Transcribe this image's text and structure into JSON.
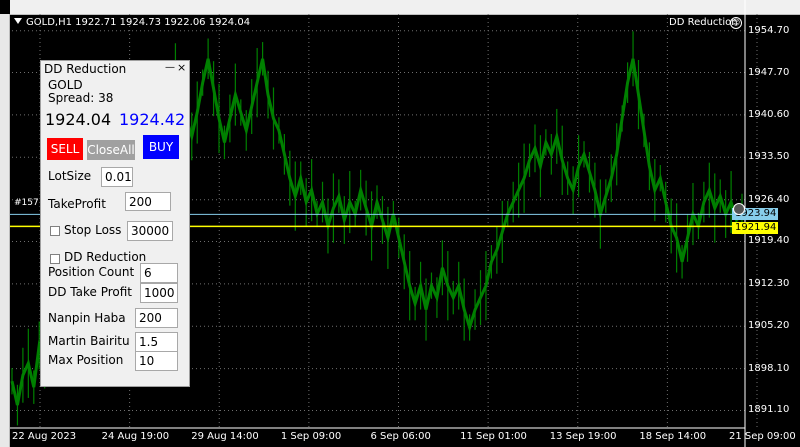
{
  "header": {
    "symbol_info": "GOLD,H1  1922.71 1924.73 1922.06 1924.04",
    "ea_name": "DD Reduction",
    "ea_icon": "smiley-icon"
  },
  "price_axis": [
    "1954.70",
    "1947.70",
    "1940.60",
    "1933.50",
    "1926.40",
    "1919.40",
    "1912.30",
    "1905.20",
    "1898.10",
    "1891.10"
  ],
  "time_axis": [
    "22 Aug 2023",
    "24 Aug 19:00",
    "29 Aug 14:00",
    "1 Sep 09:00",
    "6 Sep 06:00",
    "11 Sep 01:00",
    "13 Sep 19:00",
    "18 Sep 14:00",
    "21 Sep 09:00"
  ],
  "lines": {
    "ask_label": "1923.94",
    "bid_label": "1921.94",
    "order_tag": "#157",
    "ask_color": "#87ceeb",
    "bid_color": "#ffff00"
  },
  "panel": {
    "title": "DD Reduction",
    "min_label": "—",
    "close_label": "×",
    "symbol": "GOLD",
    "spread": "Spread: 38",
    "bid": "1924.04",
    "ask": "1924.42",
    "sell_label": "SELL",
    "closeall_label": "CloseAll",
    "buy_label": "BUY",
    "lotsize_label": "LotSize",
    "lotsize_value": "0.01",
    "takeprofit_label": "TakeProfit",
    "takeprofit_value": "200",
    "stoploss_label": "Stop Loss",
    "stoploss_value": "30000",
    "ddreduction_label": "DD Reduction",
    "position_count_label": "Position Count",
    "position_count_value": "6",
    "dd_takeprofit_label": "DD Take Profit",
    "dd_takeprofit_value": "1000",
    "nanpin_label": "Nanpin Haba",
    "nanpin_value": "200",
    "martin_label": "Martin Bairitu",
    "martin_value": "1.5",
    "maxpos_label": "Max Position",
    "maxpos_value": "10",
    "sell_color": "#ff0000",
    "buy_color": "#0000ff",
    "closeall_color": "#a0a0a0"
  },
  "chart_data": {
    "type": "line",
    "title": "",
    "xlabel": "",
    "ylabel": "",
    "ylim": [
      1888.5,
      1957.5
    ],
    "color": "#008000",
    "y": [
      1896,
      1892,
      1897,
      1899,
      1895,
      1902,
      1900,
      1905,
      1910,
      1912,
      1908,
      1914,
      1918,
      1922,
      1920,
      1926,
      1930,
      1928,
      1934,
      1938,
      1936,
      1942,
      1940,
      1938,
      1944,
      1946,
      1943,
      1939,
      1941,
      1945,
      1948,
      1944,
      1940,
      1937,
      1941,
      1946,
      1950,
      1945,
      1940,
      1936,
      1940,
      1944,
      1941,
      1938,
      1942,
      1946,
      1950,
      1944,
      1940,
      1938,
      1934,
      1930,
      1927,
      1930,
      1926,
      1928,
      1924,
      1926,
      1922,
      1925,
      1927,
      1923,
      1926,
      1924,
      1928,
      1925,
      1922,
      1926,
      1923,
      1920,
      1924,
      1920,
      1916,
      1912,
      1909,
      1912,
      1908,
      1912,
      1910,
      1915,
      1912,
      1910,
      1912,
      1908,
      1905,
      1908,
      1910,
      1912,
      1916,
      1918,
      1921,
      1924,
      1926,
      1928,
      1930,
      1933,
      1935,
      1932,
      1936,
      1934,
      1937,
      1933,
      1930,
      1928,
      1932,
      1934,
      1931,
      1928,
      1924,
      1927,
      1930,
      1934,
      1940,
      1946,
      1950,
      1944,
      1938,
      1932,
      1928,
      1930,
      1926,
      1922,
      1920,
      1916,
      1920,
      1924,
      1922,
      1926,
      1928,
      1925,
      1927,
      1924,
      1926,
      1923,
      1924
    ]
  }
}
